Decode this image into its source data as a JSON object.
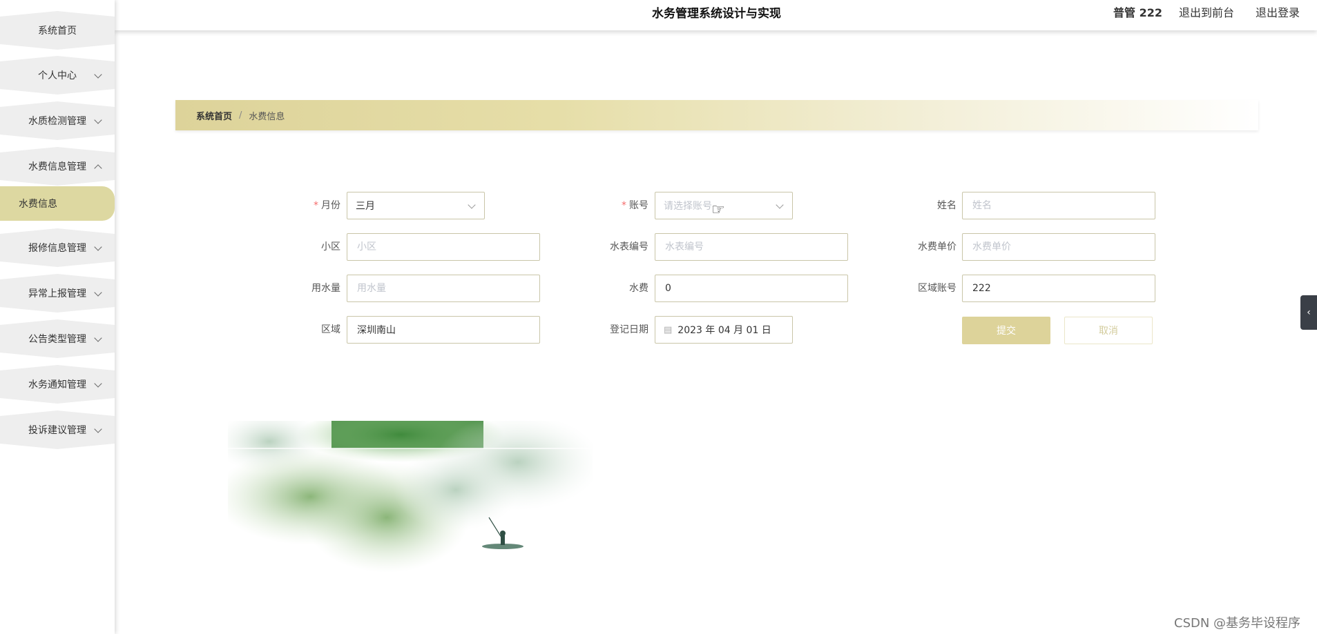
{
  "app": {
    "title": "水务管理系统设计与实现",
    "user": "普管 222",
    "to_front_label": "退出到前台",
    "logout_label": "退出登录"
  },
  "sidebar": {
    "items": [
      {
        "label": "系统首页",
        "chevron": "none"
      },
      {
        "label": "个人中心",
        "chevron": "down"
      },
      {
        "label": "水质检测管理",
        "chevron": "down"
      },
      {
        "label": "水费信息管理",
        "chevron": "up"
      },
      {
        "label": "报修信息管理",
        "chevron": "down"
      },
      {
        "label": "异常上报管理",
        "chevron": "down"
      },
      {
        "label": "公告类型管理",
        "chevron": "down"
      },
      {
        "label": "水务通知管理",
        "chevron": "down"
      },
      {
        "label": "投诉建议管理",
        "chevron": "down"
      }
    ],
    "active_sub": "水费信息"
  },
  "breadcrumb": {
    "home": "系统首页",
    "separator": "/",
    "current": "水费信息"
  },
  "form": {
    "month_label": "月份",
    "month_value": "三月",
    "account_label": "账号",
    "account_placeholder": "请选择账号",
    "name_label": "姓名",
    "name_placeholder": "姓名",
    "community_label": "小区",
    "community_placeholder": "小区",
    "meter_no_label": "水表编号",
    "meter_no_placeholder": "水表编号",
    "unit_price_label": "水费单价",
    "unit_price_placeholder": "水费单价",
    "usage_label": "用水量",
    "usage_placeholder": "用水量",
    "fee_label": "水费",
    "fee_value": "0",
    "area_account_label": "区域账号",
    "area_account_value": "222",
    "area_label": "区域",
    "area_value": "深圳南山",
    "date_label": "登记日期",
    "date_value": "2023 年 04 月 01 日",
    "submit_label": "提交",
    "cancel_label": "取消"
  },
  "icons": {
    "chevron": "chevron-down-icon",
    "calendar": "calendar-icon",
    "toggle": "chevron-left-icon"
  },
  "colors": {
    "accent": "#ddd39a",
    "active_menu": "#ddd8a1",
    "required": "#f56c6c"
  },
  "watermark": "CSDN @基务毕设程序"
}
